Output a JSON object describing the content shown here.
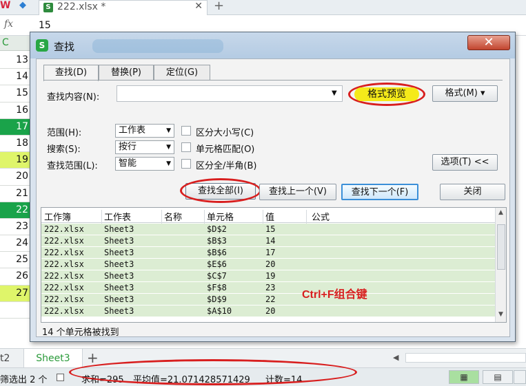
{
  "app": {
    "file_tab": "222.xlsx *"
  },
  "formula_bar": {
    "fx": "fx",
    "value": "15"
  },
  "sheet": {
    "column_header": "C",
    "rows": [
      {
        "n": "13",
        "style": ""
      },
      {
        "n": "14",
        "style": ""
      },
      {
        "n": "15",
        "style": ""
      },
      {
        "n": "16",
        "style": ""
      },
      {
        "n": "17",
        "style": "dk"
      },
      {
        "n": "18",
        "style": ""
      },
      {
        "n": "19",
        "style": "lt"
      },
      {
        "n": "20",
        "style": ""
      },
      {
        "n": "21",
        "style": ""
      },
      {
        "n": "22",
        "style": "dk"
      },
      {
        "n": "23",
        "style": ""
      },
      {
        "n": "24",
        "style": ""
      },
      {
        "n": "25",
        "style": ""
      },
      {
        "n": "26",
        "style": ""
      },
      {
        "n": "27",
        "style": "lt"
      },
      {
        "n": "",
        "style": "blank"
      }
    ]
  },
  "sheet_tabs": {
    "partial": "t2",
    "active": "Sheet3"
  },
  "status_bar": {
    "filter": "筛选出 2 个",
    "sum": "求和=295",
    "average": "平均值=21.071428571429",
    "count": "计数=14"
  },
  "dialog": {
    "title": "查找",
    "close_glyph": "✕",
    "tabs": [
      "查找(D)",
      "替换(P)",
      "定位(G)"
    ],
    "find_label": "查找内容(N):",
    "find_value": "",
    "format_preview": "格式预览",
    "format_button": "格式(M)",
    "scope_label": "范围(H):",
    "scope_value": "工作表",
    "search_label": "搜索(S):",
    "search_value": "按行",
    "lookin_label": "查找范围(L):",
    "lookin_value": "智能",
    "match_case": "区分大小写(C)",
    "match_cell": "单元格匹配(O)",
    "match_width": "区分全/半角(B)",
    "options_button": "选项(T) <<",
    "find_all": "查找全部(I)",
    "find_prev": "查找上一个(V)",
    "find_next": "查找下一个(F)",
    "close_button": "关闭",
    "columns": [
      "工作簿",
      "工作表",
      "名称",
      "单元格",
      "值",
      "公式"
    ],
    "results": [
      [
        "222.xlsx",
        "Sheet3",
        "",
        "$D$2",
        "15",
        ""
      ],
      [
        "222.xlsx",
        "Sheet3",
        "",
        "$B$3",
        "14",
        ""
      ],
      [
        "222.xlsx",
        "Sheet3",
        "",
        "$B$6",
        "17",
        ""
      ],
      [
        "222.xlsx",
        "Sheet3",
        "",
        "$E$6",
        "20",
        ""
      ],
      [
        "222.xlsx",
        "Sheet3",
        "",
        "$C$7",
        "19",
        ""
      ],
      [
        "222.xlsx",
        "Sheet3",
        "",
        "$F$8",
        "23",
        ""
      ],
      [
        "222.xlsx",
        "Sheet3",
        "",
        "$D$9",
        "22",
        ""
      ],
      [
        "222.xlsx",
        "Sheet3",
        "",
        "$A$10",
        "20",
        ""
      ]
    ],
    "hotkey_note": "Ctrl+F组合键",
    "found_status": "14 个单元格被找到"
  }
}
